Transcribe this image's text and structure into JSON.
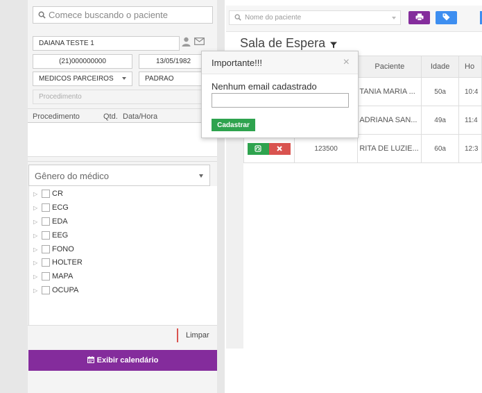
{
  "search": {
    "placeholder": "Comece buscando o paciente"
  },
  "patient": {
    "name": "DAIANA TESTE 1",
    "phone": "(21)000000000",
    "birthdate": "13/05/1982",
    "convenio": "MEDICOS PARCEIROS",
    "plano": "PADRAO",
    "procedimento_placeholder": "Procedimento"
  },
  "proc_table": {
    "headers": [
      "Procedimento",
      "Qtd.",
      "Data/Hora"
    ]
  },
  "genero": {
    "placeholder": "Gênero do médico"
  },
  "tree": {
    "items": [
      "CR",
      "ECG",
      "EDA",
      "EEG",
      "FONO",
      "HOLTER",
      "MAPA",
      "OCUPA"
    ]
  },
  "limpar": "Limpar",
  "calendar_button": "Exibir calendário",
  "right": {
    "nome_placeholder": "Nome do paciente",
    "title": "Sala de Espera",
    "table": {
      "headers": [
        "Paciente",
        "Idade",
        "Ho"
      ],
      "rows": [
        {
          "codigo": "",
          "paciente": "TANIA MARIA ...",
          "idade": "50a",
          "hora": "10:4"
        },
        {
          "codigo": "",
          "paciente": "ADRIANA SAN...",
          "idade": "49a",
          "hora": "11:4"
        },
        {
          "codigo": "123500",
          "paciente": "RITA DE LUZIE...",
          "idade": "60a",
          "hora": "12:3"
        }
      ]
    }
  },
  "popover": {
    "title": "Importante!!!",
    "close": "×",
    "label": "Nenhum email cadastrado",
    "button": "Cadastrar"
  },
  "colors": {
    "purple": "#842c9c",
    "blue": "#3d8ef0",
    "green": "#2ea34e",
    "red": "#d9534f"
  }
}
